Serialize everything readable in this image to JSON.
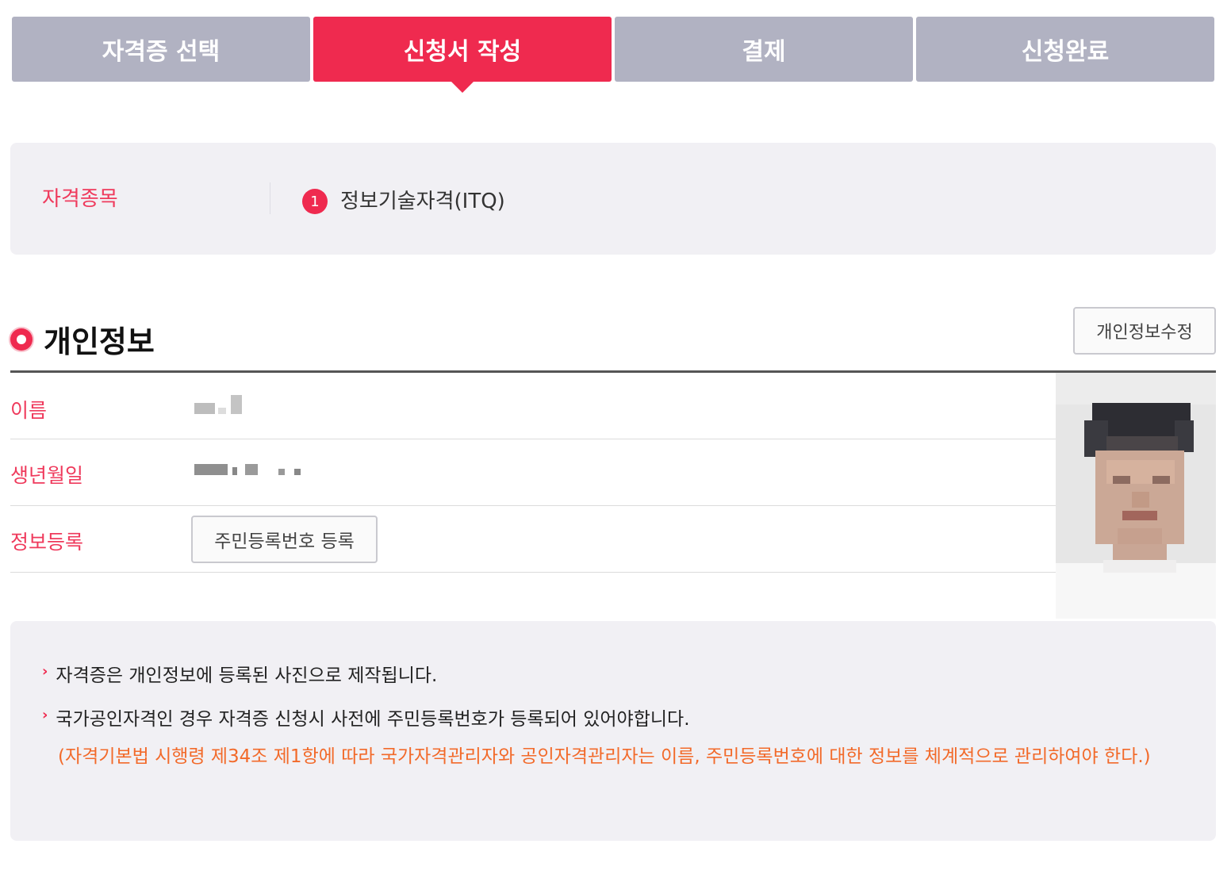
{
  "steps": [
    {
      "label": "자격증 선택",
      "active": false
    },
    {
      "label": "신청서 작성",
      "active": true
    },
    {
      "label": "결제",
      "active": false
    },
    {
      "label": "신청완료",
      "active": false
    }
  ],
  "qualification": {
    "label": "자격종목",
    "items": [
      {
        "num": "1",
        "name": "정보기술자격(ITQ)"
      }
    ]
  },
  "personal": {
    "title": "개인정보",
    "edit_button": "개인정보수정",
    "rows": {
      "name_label": "이름",
      "birth_label": "생년월일",
      "register_label": "정보등록",
      "register_button": "주민등록번호 등록"
    }
  },
  "notice": {
    "item1": "자격증은 개인정보에 등록된 사진으로 제작됩니다.",
    "item2": "국가공인자격인 경우 자격증 신청시 사전에 주민등록번호가 등록되어 있어야합니다.",
    "item2_note": "(자격기본법 시행령 제34조 제1항에 따라 국가자격관리자와 공인자격관리자는 이름, 주민등록번호에 대한 정보를 체계적으로 관리하여야 한다.)"
  },
  "colors": {
    "accent": "#ef2a4f",
    "step_inactive": "#b1b2c2",
    "notice_orange": "#f26a2a"
  }
}
